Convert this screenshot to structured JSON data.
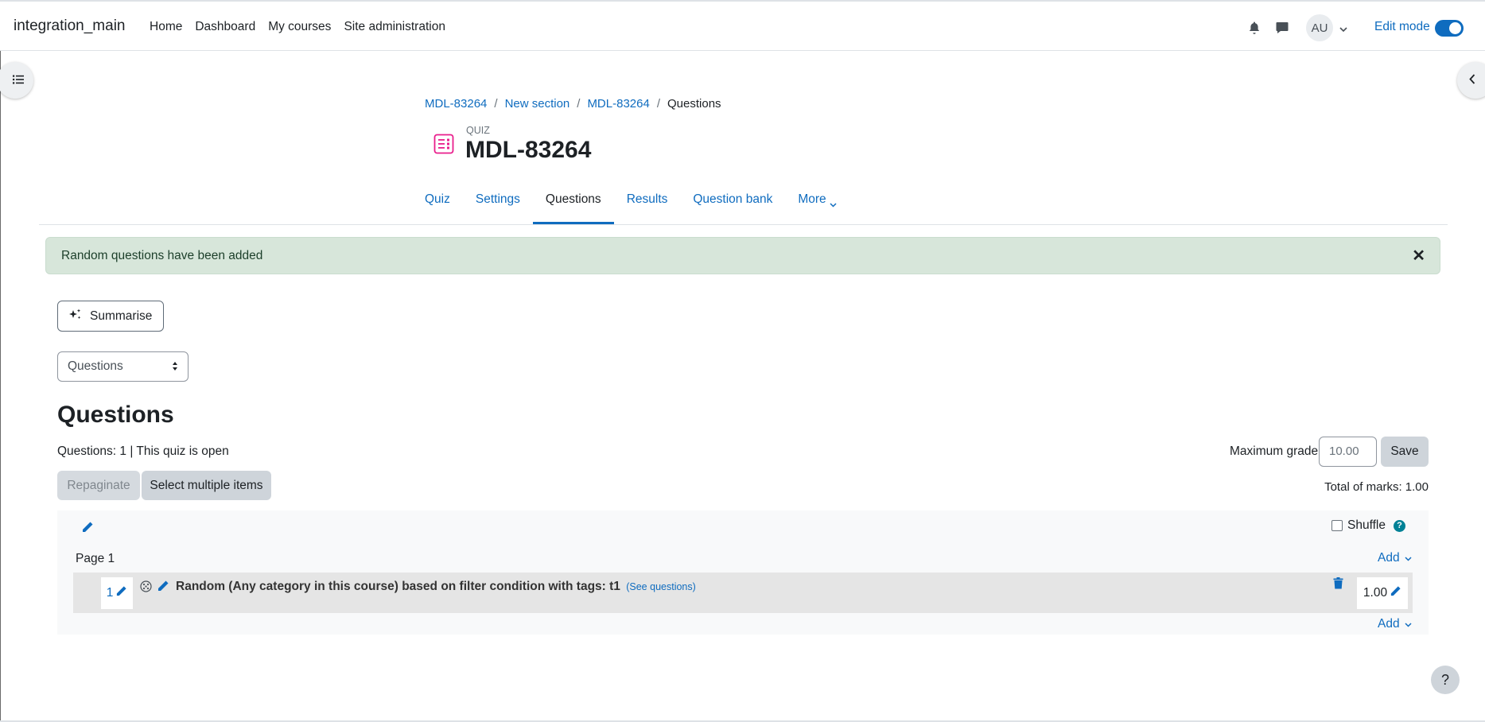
{
  "navbar": {
    "brand": "integration_main",
    "items": [
      "Home",
      "Dashboard",
      "My courses",
      "Site administration"
    ],
    "avatar_initials": "AU",
    "edit_mode_label": "Edit mode",
    "edit_mode_on": true
  },
  "breadcrumb": [
    "MDL-83264",
    "New section",
    "MDL-83264",
    "Questions"
  ],
  "header": {
    "activity_type": "QUIZ",
    "title": "MDL-83264",
    "icon_color": "#e91e8c"
  },
  "tabs": [
    {
      "label": "Quiz",
      "active": false
    },
    {
      "label": "Settings",
      "active": false
    },
    {
      "label": "Questions",
      "active": true
    },
    {
      "label": "Results",
      "active": false
    },
    {
      "label": "Question bank",
      "active": false
    },
    {
      "label": "More",
      "active": false
    }
  ],
  "alert": {
    "message": "Random questions have been added",
    "close_glyph": "✕"
  },
  "summarise_button": "Summarise",
  "view_select": {
    "selected": "Questions"
  },
  "main": {
    "heading": "Questions",
    "status": "Questions: 1 | This quiz is open",
    "repaginate_label": "Repaginate",
    "select_multiple_label": "Select multiple items",
    "max_grade_label": "Maximum grade",
    "max_grade_value": "10.00",
    "save_label": "Save",
    "total_marks": "Total of marks: 1.00"
  },
  "section": {
    "shuffle_label": "Shuffle",
    "page_label": "Page 1",
    "add_label": "Add",
    "questions": [
      {
        "number": "1",
        "text": "Random (Any category in this course) based on filter condition with tags: t1",
        "see_questions": "(See questions)",
        "mark": "1.00"
      }
    ]
  },
  "help_button": "?",
  "colors": {
    "primary": "#0f6cbf",
    "alert_bg": "#d7e6da",
    "help_icon": "#008196"
  }
}
